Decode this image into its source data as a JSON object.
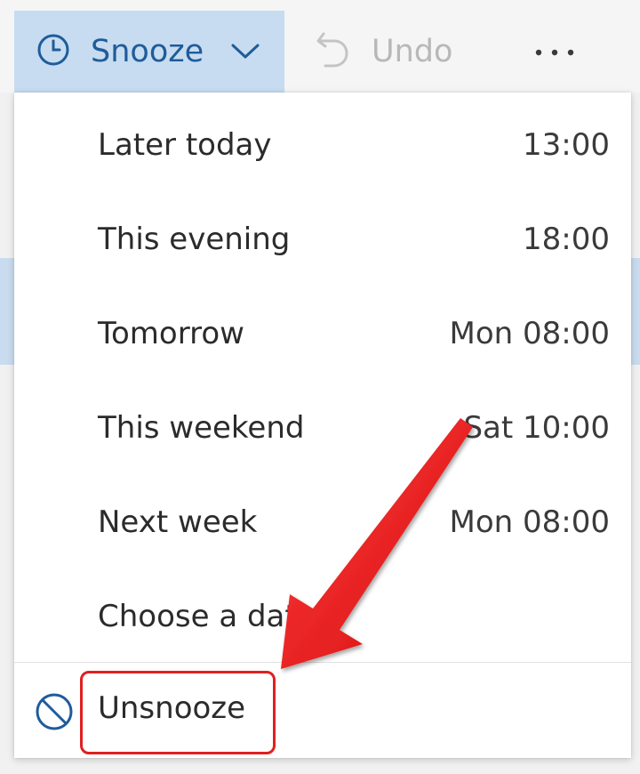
{
  "toolbar": {
    "snooze_label": "Snooze",
    "undo_label": "Undo",
    "more_label": "···"
  },
  "menu": {
    "items": [
      {
        "label": "Later today",
        "time": "13:00"
      },
      {
        "label": "This evening",
        "time": "18:00"
      },
      {
        "label": "Tomorrow",
        "time": "Mon 08:00"
      },
      {
        "label": "This weekend",
        "time": "Sat 10:00"
      },
      {
        "label": "Next week",
        "time": "Mon 08:00"
      },
      {
        "label": "Choose a date",
        "time": ""
      }
    ],
    "unsnooze_label": "Unsnooze"
  },
  "colors": {
    "accent": "#1f5c9a",
    "snooze_bg": "#c7dcf0",
    "annotation_red": "#e02020"
  },
  "icons": {
    "snooze": "clock-icon",
    "dropdown": "chevron-down-icon",
    "undo": "undo-icon",
    "more": "more-icon",
    "unsnooze": "prohibited-icon"
  }
}
